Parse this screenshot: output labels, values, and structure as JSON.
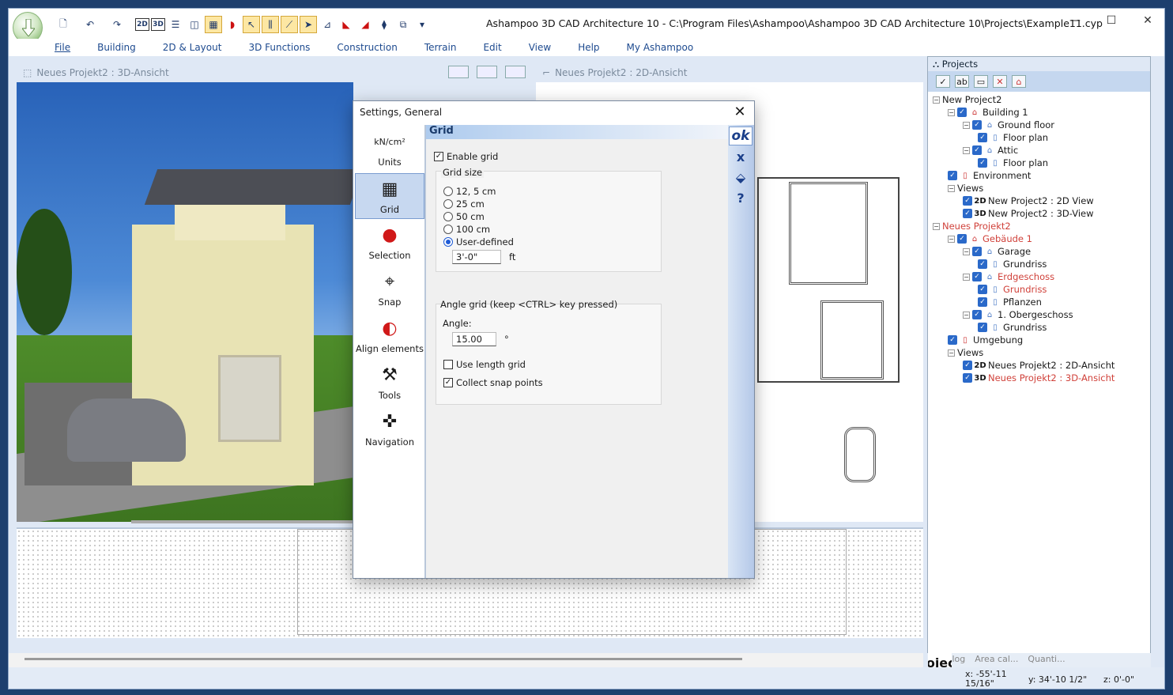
{
  "window": {
    "title": "Ashampoo 3D CAD Architecture 10 - C:\\Program Files\\Ashampoo\\Ashampoo 3D CAD Architecture 10\\Projects\\Example11.cyp",
    "controls": {
      "minimize": "—",
      "maximize": "☐",
      "close": "✕"
    }
  },
  "quick_access": {
    "view_2d": "2D",
    "view_3d": "3D",
    "more": "▾"
  },
  "menu": [
    "File",
    "Building",
    "2D & Layout",
    "3D Functions",
    "Construction",
    "Terrain",
    "Edit",
    "View",
    "Help",
    "My Ashampoo"
  ],
  "views": {
    "view3d_title": "Neues Projekt2 : 3D-Ansicht",
    "view2d_title": "Neues Projekt2 : 2D-Ansicht"
  },
  "dialog": {
    "title": "Settings, General",
    "close": "✕",
    "sidebar": [
      {
        "label": "Units",
        "icon": "units-icon",
        "glyph": "kN/cm²"
      },
      {
        "label": "Grid",
        "icon": "grid-icon",
        "glyph": "▦"
      },
      {
        "label": "Selection",
        "icon": "selection-icon",
        "glyph": "●"
      },
      {
        "label": "Snap",
        "icon": "snap-icon",
        "glyph": "⌖"
      },
      {
        "label": "Align elements",
        "icon": "magnet-icon",
        "glyph": "◐"
      },
      {
        "label": "Tools",
        "icon": "tools-icon",
        "glyph": "⚒"
      },
      {
        "label": "Navigation",
        "icon": "navigation-icon",
        "glyph": "✜"
      }
    ],
    "section_title": "Grid",
    "enable_grid": {
      "label": "Enable grid",
      "checked": true
    },
    "grid_size": {
      "label": "Grid size",
      "options": [
        "12, 5 cm",
        "25 cm",
        "50 cm",
        "100 cm",
        "User-defined"
      ],
      "selected": "User-defined",
      "value": "3'-0\"",
      "unit": "ft"
    },
    "angle_grid": {
      "label": "Angle grid (keep <CTRL> key pressed)",
      "angle_label": "Angle:",
      "angle_value": "15.00",
      "angle_unit": "°",
      "use_length_grid": {
        "label": "Use length grid",
        "checked": false
      },
      "collect_snap_points": {
        "label": "Collect snap points",
        "checked": true
      }
    },
    "actions": {
      "ok": "ok",
      "cancel": "x",
      "save": "⬙",
      "help": "?"
    }
  },
  "projects_panel": {
    "title": "Projects",
    "tree": [
      {
        "label": "New Project2",
        "level": 0,
        "expander": "⊟"
      },
      {
        "label": "Building 1",
        "level": 1,
        "checked": true,
        "expander": "⊟"
      },
      {
        "label": "Ground floor",
        "level": 2,
        "checked": true,
        "expander": "⊟"
      },
      {
        "label": "Floor plan",
        "level": 3,
        "checked": true
      },
      {
        "label": "Attic",
        "level": 2,
        "checked": true,
        "expander": "⊟"
      },
      {
        "label": "Floor plan",
        "level": 3,
        "checked": true
      },
      {
        "label": "Environment",
        "level": 1,
        "checked": true
      },
      {
        "label": "Views",
        "level": 1,
        "expander": "⊟"
      },
      {
        "label": "New Project2 : 2D View",
        "level": 2,
        "checked": true,
        "tag": "2D"
      },
      {
        "label": "New Project2 : 3D-View",
        "level": 2,
        "checked": true,
        "tag": "3D"
      },
      {
        "label": "Neues Projekt2",
        "level": 0,
        "red": true,
        "expander": "⊟"
      },
      {
        "label": "Gebäude 1",
        "level": 1,
        "checked": true,
        "red": true,
        "expander": "⊟"
      },
      {
        "label": "Garage",
        "level": 2,
        "checked": true,
        "expander": "⊟"
      },
      {
        "label": "Grundriss",
        "level": 3,
        "checked": true
      },
      {
        "label": "Erdgeschoss",
        "level": 2,
        "checked": true,
        "red": true,
        "expander": "⊟"
      },
      {
        "label": "Grundriss",
        "level": 3,
        "checked": true,
        "red": true
      },
      {
        "label": "Pflanzen",
        "level": 3,
        "checked": true
      },
      {
        "label": "1. Obergeschoss",
        "level": 2,
        "checked": true,
        "expander": "⊟"
      },
      {
        "label": "Grundriss",
        "level": 3,
        "checked": true
      },
      {
        "label": "Umgebung",
        "level": 1,
        "checked": true
      },
      {
        "label": "Views",
        "level": 1,
        "expander": "⊟"
      },
      {
        "label": "Neues Projekt2 : 2D-Ansicht",
        "level": 2,
        "checked": true,
        "tag": "2D"
      },
      {
        "label": "Neues Projekt2 : 3D-Ansicht",
        "level": 2,
        "checked": true,
        "tag": "3D",
        "red": true
      }
    ],
    "tabs": [
      "Catalog",
      "Projects",
      "Area cal...",
      "Quanti..."
    ],
    "active_tab": "Projects"
  },
  "status": {
    "x": "x: -55'-11",
    "x2": "15/16\"",
    "y": "y: 34'-10 1/2\"",
    "z": "z: 0'-0\""
  }
}
